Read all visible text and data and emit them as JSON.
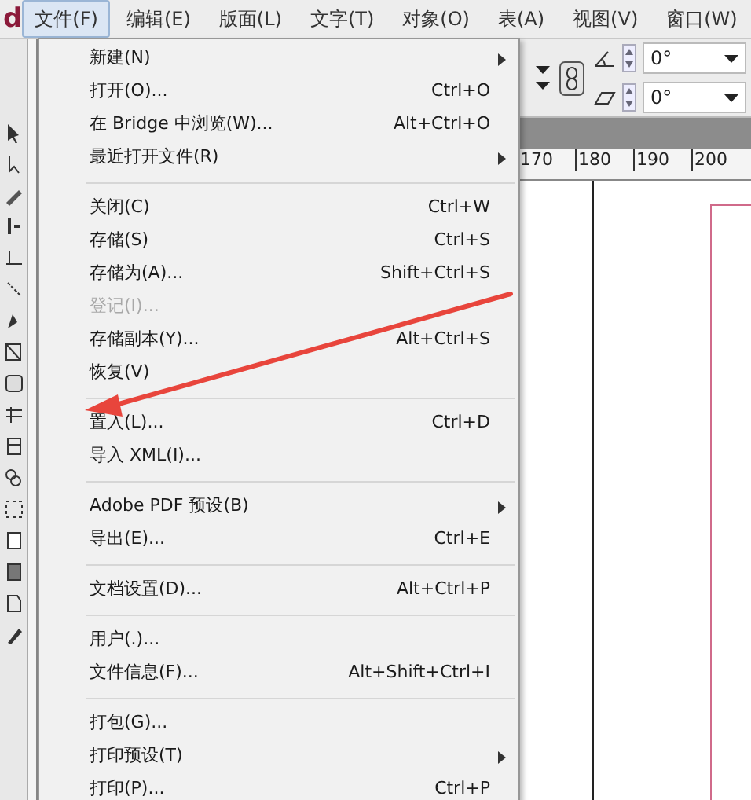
{
  "app_logo": "d",
  "menubar": [
    {
      "label": "文件(F)",
      "selected": true
    },
    {
      "label": "编辑(E)",
      "selected": false
    },
    {
      "label": "版面(L)",
      "selected": false
    },
    {
      "label": "文字(T)",
      "selected": false
    },
    {
      "label": "对象(O)",
      "selected": false
    },
    {
      "label": "表(A)",
      "selected": false
    },
    {
      "label": "视图(V)",
      "selected": false
    },
    {
      "label": "窗口(W)",
      "selected": false
    }
  ],
  "control_panel": {
    "fields": [
      {
        "value": "0°"
      },
      {
        "value": "0°"
      }
    ]
  },
  "ruler": {
    "labels": [
      "170",
      "180",
      "190",
      "200"
    ]
  },
  "file_menu": [
    {
      "kind": "item",
      "label": "新建(N)",
      "submenu": true,
      "disabled": false
    },
    {
      "kind": "item",
      "label": "打开(O)...",
      "shortcut": "Ctrl+O",
      "submenu": false,
      "disabled": false
    },
    {
      "kind": "item",
      "label": "在 Bridge 中浏览(W)...",
      "shortcut": "Alt+Ctrl+O",
      "submenu": false,
      "disabled": false
    },
    {
      "kind": "item",
      "label": "最近打开文件(R)",
      "submenu": true,
      "disabled": false
    },
    {
      "kind": "separator"
    },
    {
      "kind": "item",
      "label": "关闭(C)",
      "shortcut": "Ctrl+W",
      "submenu": false,
      "disabled": false
    },
    {
      "kind": "item",
      "label": "存储(S)",
      "shortcut": "Ctrl+S",
      "submenu": false,
      "disabled": false
    },
    {
      "kind": "item",
      "label": "存储为(A)...",
      "shortcut": "Shift+Ctrl+S",
      "submenu": false,
      "disabled": false
    },
    {
      "kind": "item",
      "label": "登记(I)...",
      "submenu": false,
      "disabled": true
    },
    {
      "kind": "item",
      "label": "存储副本(Y)...",
      "shortcut": "Alt+Ctrl+S",
      "submenu": false,
      "disabled": false
    },
    {
      "kind": "item",
      "label": "恢复(V)",
      "submenu": false,
      "disabled": false
    },
    {
      "kind": "separator"
    },
    {
      "kind": "item",
      "label": "置入(L)...",
      "shortcut": "Ctrl+D",
      "submenu": false,
      "disabled": false
    },
    {
      "kind": "item",
      "label": "导入 XML(I)...",
      "submenu": false,
      "disabled": false
    },
    {
      "kind": "separator"
    },
    {
      "kind": "item",
      "label": "Adobe PDF 预设(B)",
      "submenu": true,
      "disabled": false
    },
    {
      "kind": "item",
      "label": "导出(E)...",
      "shortcut": "Ctrl+E",
      "submenu": false,
      "disabled": false
    },
    {
      "kind": "separator"
    },
    {
      "kind": "item",
      "label": "文档设置(D)...",
      "shortcut": "Alt+Ctrl+P",
      "submenu": false,
      "disabled": false
    },
    {
      "kind": "separator"
    },
    {
      "kind": "item",
      "label": "用户(.)...",
      "submenu": false,
      "disabled": false
    },
    {
      "kind": "item",
      "label": "文件信息(F)...",
      "shortcut": "Alt+Shift+Ctrl+I",
      "submenu": false,
      "disabled": false
    },
    {
      "kind": "separator"
    },
    {
      "kind": "item",
      "label": "打包(G)...",
      "submenu": false,
      "disabled": false
    },
    {
      "kind": "item",
      "label": "打印预设(T)",
      "submenu": true,
      "disabled": false
    },
    {
      "kind": "item",
      "label": "打印(P)...",
      "shortcut": "Ctrl+P",
      "submenu": false,
      "disabled": false
    }
  ]
}
